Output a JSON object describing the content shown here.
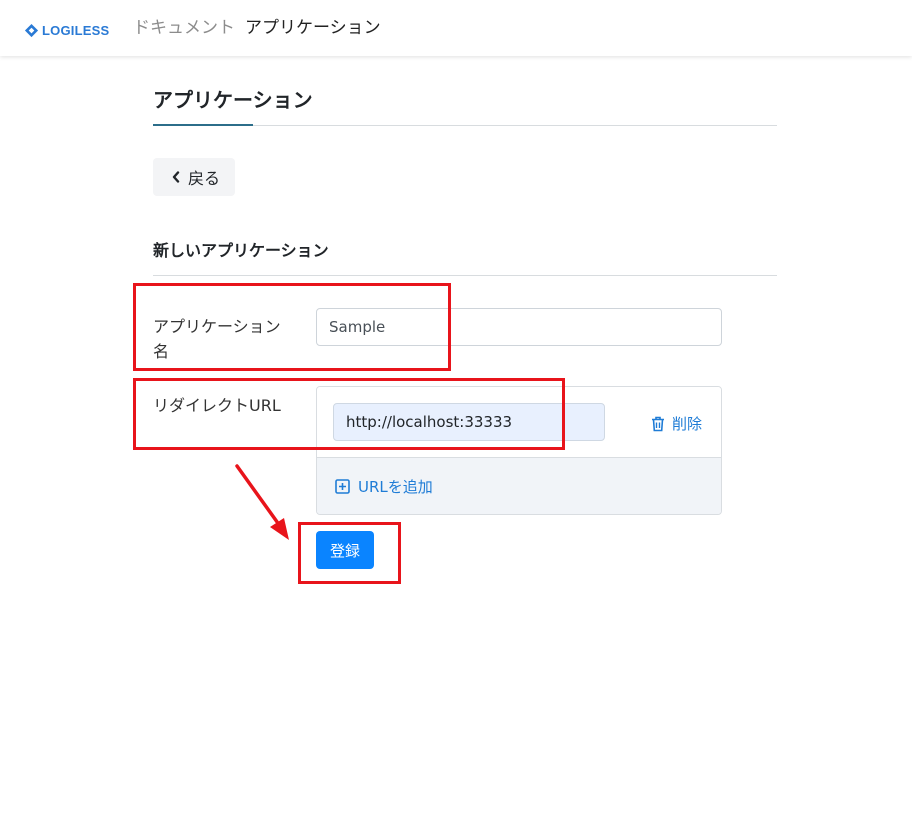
{
  "header": {
    "brand": "LOGILESS",
    "nav": [
      {
        "label": "ドキュメント"
      },
      {
        "label": "アプリケーション"
      }
    ]
  },
  "page": {
    "title": "アプリケーション",
    "back_label": "戻る"
  },
  "form": {
    "section_title": "新しいアプリケーション",
    "name_label": "アプリケーション名",
    "name_value": "Sample",
    "redirect_label": "リダイレクトURL",
    "redirect_urls": [
      "http://localhost:33333"
    ],
    "delete_label": "削除",
    "add_url_label": "URLを追加",
    "submit_label": "登録"
  },
  "icons": {
    "brand": "logo-diamond-icon",
    "back": "chevron-left-icon",
    "delete": "trash-icon",
    "add": "plus-square-icon"
  },
  "colors": {
    "brand": "#2a7ad5",
    "link": "#1f7cd6",
    "primary_button": "#0a84ff",
    "annotation": "#e8141b",
    "url_field_fill": "#e8f0fe"
  }
}
